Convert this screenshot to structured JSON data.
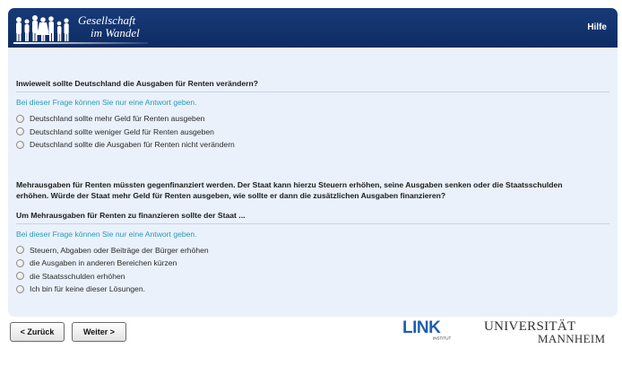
{
  "header": {
    "logo_line1": "Gesellschaft",
    "logo_line2": "im Wandel",
    "help_label": "Hilfe"
  },
  "question1": {
    "title": "Inwieweit sollte Deutschland die Ausgaben für Renten verändern?",
    "hint": "Bei dieser Frage können Sie nur eine Antwort geben.",
    "options": [
      "Deutschland sollte mehr Geld für Renten ausgeben",
      "Deutschland sollte weniger Geld für Renten ausgeben",
      "Deutschland sollte die Ausgaben für Renten nicht verändern"
    ]
  },
  "intro": {
    "line1": "Mehrausgaben für Renten müssten gegenfinanziert werden. Der Staat kann hierzu Steuern erhöhen, seine Ausgaben senken oder die Staatsschulden",
    "line2": "erhöhen. Würde der Staat mehr Geld für Renten ausgeben, wie sollte er dann die zusätzlichen Ausgaben finanzieren?"
  },
  "question2": {
    "title": "Um Mehrausgaben für Renten zu finanzieren sollte der Staat ...",
    "hint": "Bei dieser Frage können Sie nur eine Antwort geben.",
    "options": [
      "Steuern, Abgaben oder Beiträge der Bürger erhöhen",
      "die Ausgaben in anderen Bereichen kürzen",
      "die Staatsschulden erhöhen",
      "Ich bin für keine dieser Lösungen."
    ]
  },
  "nav": {
    "back_label": "< Zurück",
    "next_label": "Weiter >"
  },
  "footer": {
    "link_logo": "LINK",
    "link_sub": "INSTITUT",
    "uni_line1": "UNIVERSITÄT",
    "uni_line2": "MANNHEIM"
  },
  "colors": {
    "header": "#173a78",
    "panel": "#eaf1fb",
    "hint": "#2a9bb5",
    "link_logo": "#1f5fae"
  }
}
